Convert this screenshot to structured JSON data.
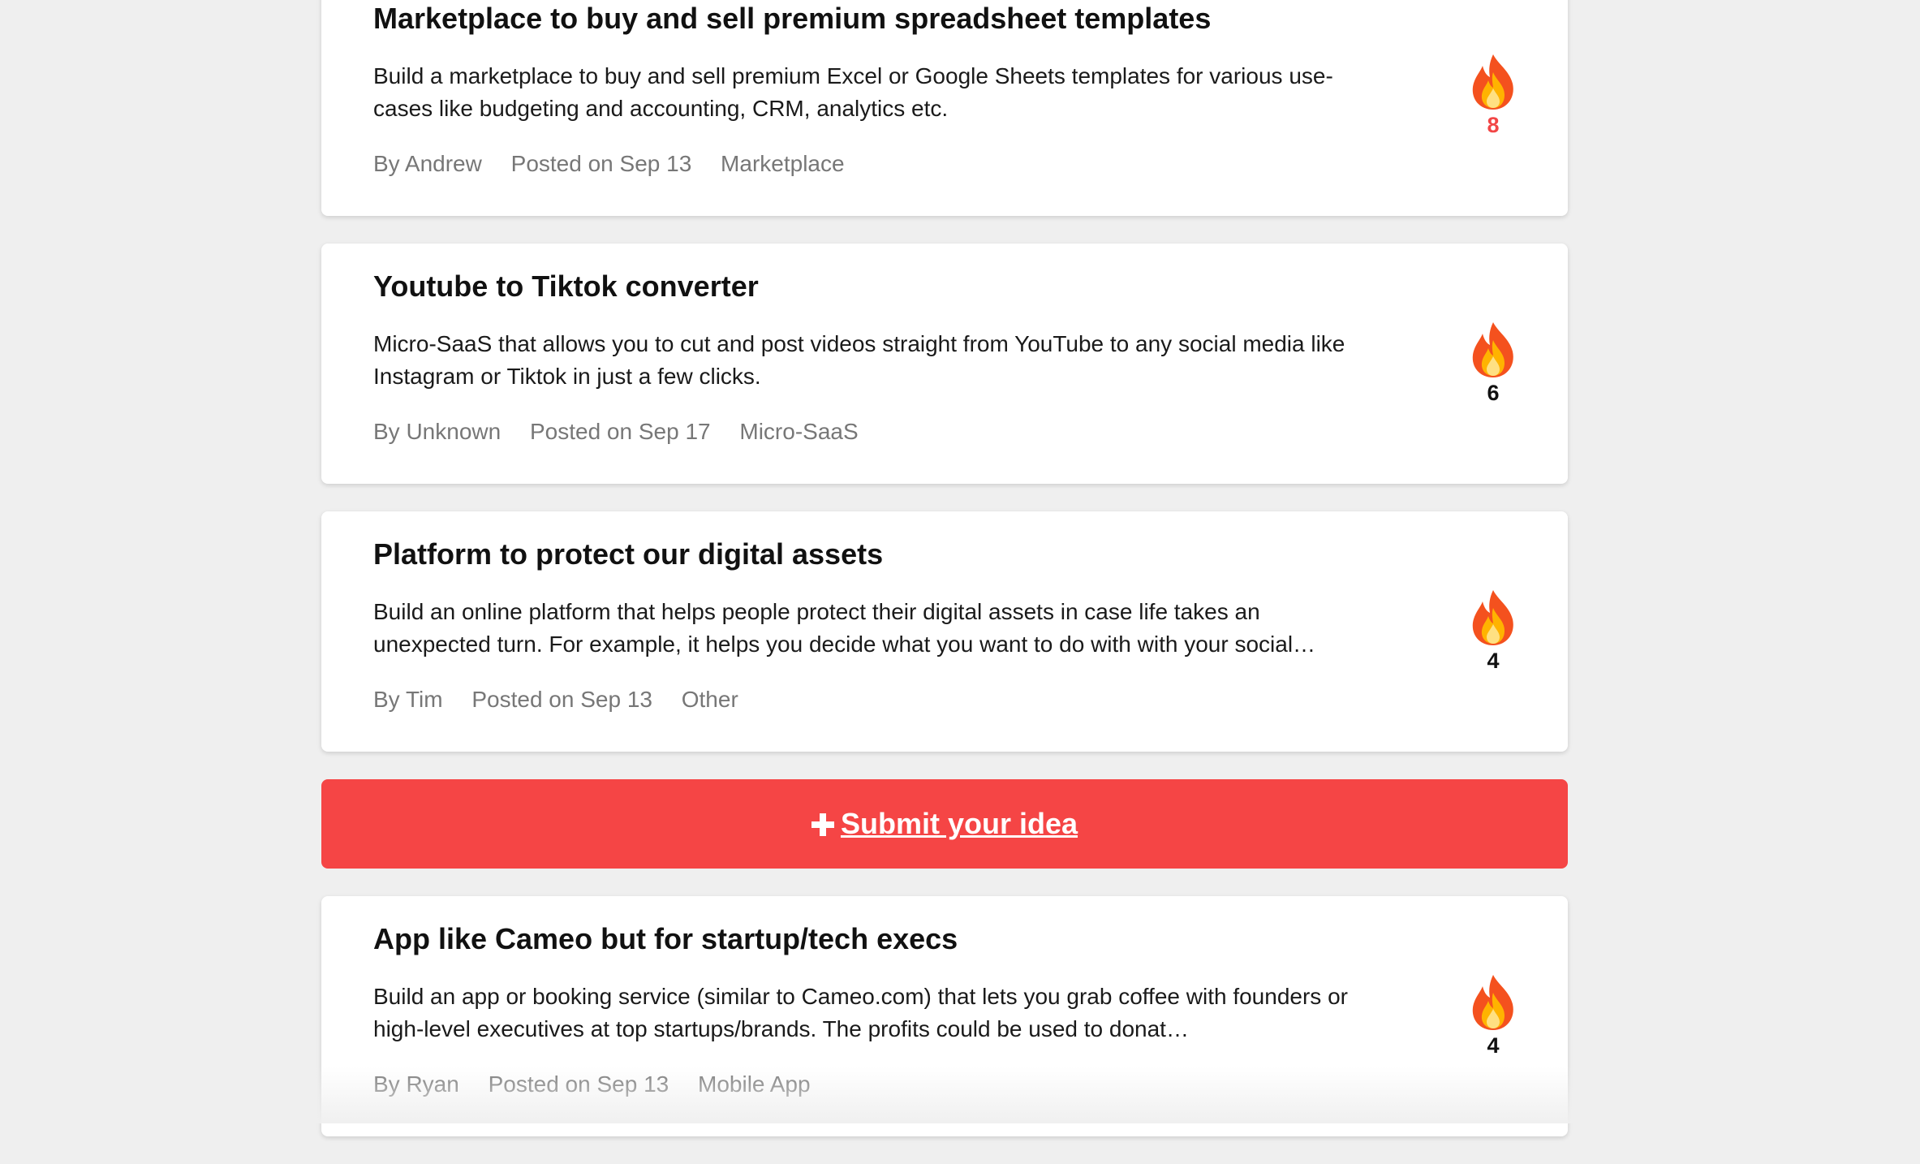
{
  "ideas": [
    {
      "title": "Marketplace to buy and sell premium spreadsheet templates",
      "description": "Build a marketplace to buy and sell premium Excel or Google Sheets templates for various use-cases like budgeting and accounting, CRM, analytics etc.",
      "author": "By Andrew",
      "posted": "Posted on Sep 13",
      "category": "Marketplace",
      "votes": "8",
      "hot": true
    },
    {
      "title": "Youtube to Tiktok converter",
      "description": "Micro-SaaS that allows you to cut and post videos straight from YouTube to any social media like Instagram or Tiktok in just a few clicks.",
      "author": "By Unknown",
      "posted": "Posted on Sep 17",
      "category": "Micro-SaaS",
      "votes": "6",
      "hot": false
    },
    {
      "title": "Platform to protect our digital assets",
      "description": "Build an online platform that helps people protect their digital assets in case life takes an unexpected turn. For example, it helps you decide what you want to do with with your social…",
      "author": "By Tim",
      "posted": "Posted on Sep 13",
      "category": "Other",
      "votes": "4",
      "hot": false
    },
    {
      "title": "App like Cameo but for startup/tech execs",
      "description": "Build an app or booking service (similar to Cameo.com) that lets you grab coffee with founders or high-level executives at top startups/brands. The profits could be used to donat…",
      "author": "By Ryan",
      "posted": "Posted on Sep 13",
      "category": "Mobile App",
      "votes": "4",
      "hot": false
    }
  ],
  "submit": {
    "icon": "plus-icon",
    "label": "Submit your idea"
  },
  "vote_icon": "fire-icon",
  "colors": {
    "accent": "#f54545",
    "hot_count": "#f24646",
    "background": "#efefef",
    "card": "#ffffff",
    "meta_text": "#777777"
  }
}
